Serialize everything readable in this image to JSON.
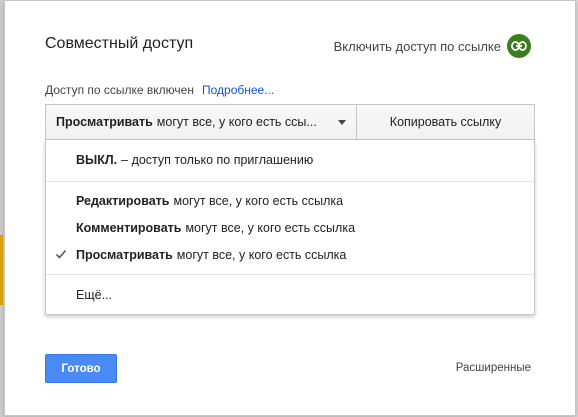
{
  "dialog": {
    "title": "Совместный доступ",
    "link_toggle_label": "Включить доступ по ссылке",
    "link_icon": "link-icon",
    "status_text": "Доступ по ссылке включен",
    "more_link": "Подробнее..."
  },
  "access_select": {
    "selected_bold": "Просматривать",
    "selected_rest": "могут все, у кого есть ссы...",
    "arrow_icon": "caret-down-icon"
  },
  "copy_button": "Копировать ссылку",
  "menu": {
    "items": [
      {
        "bold": "ВЫКЛ.",
        "rest": "– доступ только по приглашению",
        "checked": false
      },
      {
        "bold": "Редактировать",
        "rest": "могут все, у кого есть ссылка",
        "checked": false
      },
      {
        "bold": "Комментировать",
        "rest": "могут все, у кого есть ссылка",
        "checked": false
      },
      {
        "bold": "Просматривать",
        "rest": "могут все, у кого есть ссылка",
        "checked": true
      },
      {
        "bold": "",
        "rest": "Ещё...",
        "checked": false
      }
    ]
  },
  "footer": {
    "done": "Готово",
    "advanced": "Расширенные"
  },
  "colors": {
    "accent_blue": "#4a8af4",
    "link_green": "#3b7d1f",
    "link_blue": "#1155cc"
  }
}
